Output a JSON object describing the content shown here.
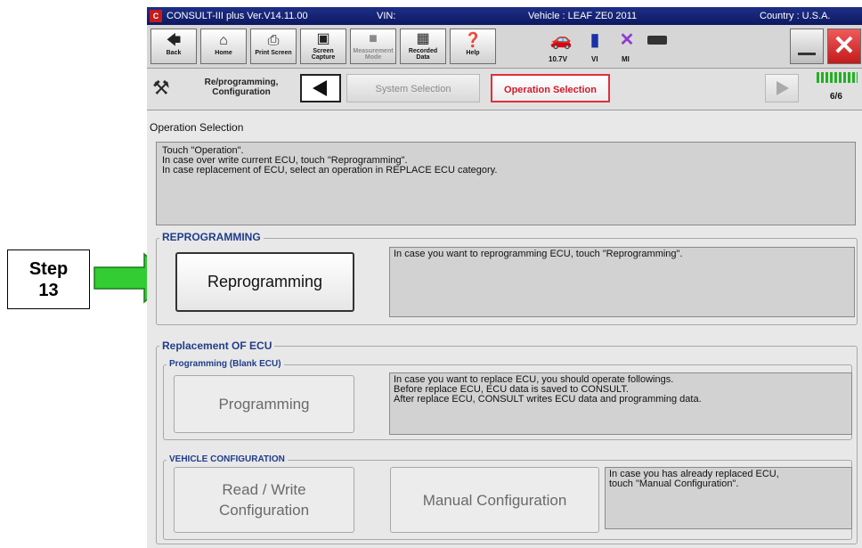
{
  "callout": {
    "line1": "Step",
    "line2": "13"
  },
  "window": {
    "title": "CONSULT-III plus  Ver.V14.11.00",
    "vin_label": "VIN:",
    "vehicle": "Vehicle : LEAF ZE0 2011",
    "country": "Country : U.S.A."
  },
  "toolbar": {
    "back": "Back",
    "home": "Home",
    "print_screen": "Print Screen",
    "screen_capture_1": "Screen",
    "screen_capture_2": "Capture",
    "measurement_1": "Measurement",
    "measurement_2": "Mode",
    "recorded_1": "Recorded",
    "recorded_2": "Data",
    "help": "Help",
    "voltage": "10.7V",
    "vi": "VI",
    "mi": "MI"
  },
  "nav": {
    "reprog_1": "Re/programming,",
    "reprog_2": "Configuration",
    "system_selection": "System Selection",
    "operation_selection": "Operation Selection",
    "page": "6/6"
  },
  "main": {
    "title": "Operation Selection",
    "instructions": [
      "Touch \"Operation\".",
      "In case over write current ECU, touch \"Reprogramming\".",
      "In case replacement of ECU, select an operation in REPLACE ECU category."
    ],
    "reprogramming": {
      "label": "REPROGRAMMING",
      "button": "Reprogramming",
      "desc": "In case you want to reprogramming ECU, touch \"Reprogramming\"."
    },
    "replacement": {
      "label": "Replacement OF ECU",
      "programming_label": "Programming (Blank ECU)",
      "programming_button": "Programming",
      "programming_desc": [
        "In case you want to replace ECU, you should operate followings.",
        "Before replace ECU, ECU data is saved to CONSULT.",
        "After replace ECU, CONSULT writes ECU data and programming data."
      ],
      "vc_label": "VEHICLE CONFIGURATION",
      "rw_1": "Read / Write",
      "rw_2": "Configuration",
      "manual": "Manual Configuration",
      "vc_desc": [
        "In case you has already replaced ECU,",
        "touch \"Manual Configuration\"."
      ]
    }
  }
}
